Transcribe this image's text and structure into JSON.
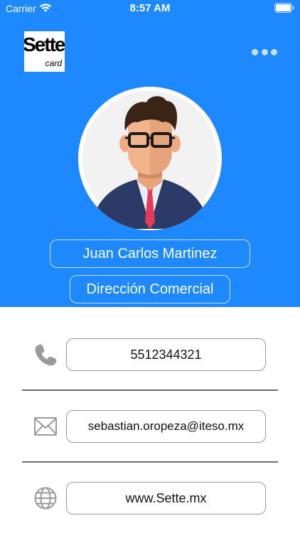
{
  "status_bar": {
    "carrier": "Carrier",
    "time": "8:57 AM"
  },
  "logo": {
    "word": "Sette",
    "sub": "card"
  },
  "profile": {
    "name": "Juan Carlos Martinez",
    "role": "Dirección Comercial"
  },
  "contact": {
    "phone": "5512344321",
    "email": "sebastian.oropeza@iteso.mx",
    "website": "www.Sette.mx"
  },
  "colors": {
    "header_bg": "#1E88FF",
    "icon_gray": "#9a9a9a",
    "divider": "#6f6f6f"
  },
  "icons": {
    "wifi": "wifi-icon",
    "battery": "battery-icon",
    "more": "more-options-icon",
    "phone": "phone-icon",
    "mail": "mail-icon",
    "globe": "globe-icon"
  }
}
